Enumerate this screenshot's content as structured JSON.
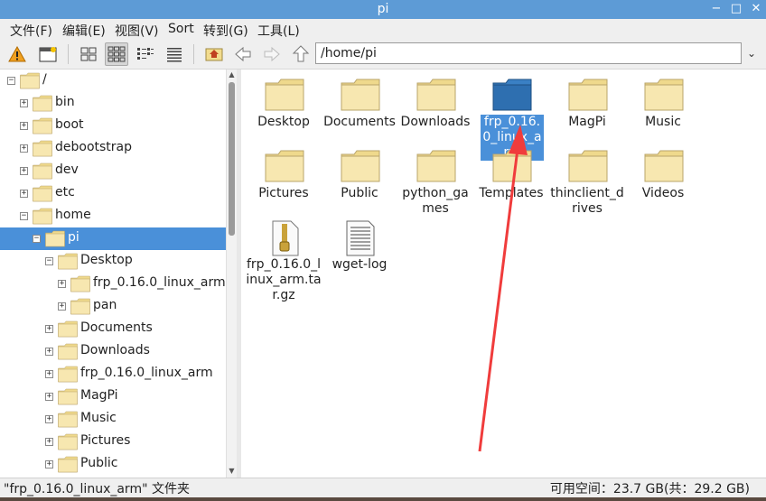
{
  "window": {
    "title": "pi",
    "minimize": "−",
    "maximize": "□",
    "close": "✕"
  },
  "menu": [
    "文件(F)",
    "编辑(E)",
    "视图(V)",
    "Sort",
    "转到(G)",
    "工具(L)"
  ],
  "toolbar": {
    "icons": [
      "warning-icon",
      "new-window-icon",
      "icon-view-icon",
      "thumbnail-view-icon",
      "compact-view-icon",
      "list-view-icon",
      "home-icon",
      "back-icon",
      "forward-icon",
      "up-icon"
    ],
    "address": "/home/pi",
    "address_dropdown": "⌄"
  },
  "tree": [
    {
      "label": "/",
      "expander": "−"
    },
    {
      "label": "bin",
      "expander": "+"
    },
    {
      "label": "boot",
      "expander": "+"
    },
    {
      "label": "debootstrap",
      "expander": "+"
    },
    {
      "label": "dev",
      "expander": "+"
    },
    {
      "label": "etc",
      "expander": "+"
    },
    {
      "label": "home",
      "expander": "−"
    },
    {
      "label": "pi",
      "expander": "−"
    },
    {
      "label": "Desktop",
      "expander": "−"
    },
    {
      "label": "frp_0.16.0_linux_arm",
      "expander": "+"
    },
    {
      "label": "pan",
      "expander": "+"
    },
    {
      "label": "Documents",
      "expander": "+"
    },
    {
      "label": "Downloads",
      "expander": "+"
    },
    {
      "label": "frp_0.16.0_linux_arm",
      "expander": "+"
    },
    {
      "label": "MagPi",
      "expander": "+"
    },
    {
      "label": "Music",
      "expander": "+"
    },
    {
      "label": "Pictures",
      "expander": "+"
    },
    {
      "label": "Public",
      "expander": "+"
    }
  ],
  "files": [
    {
      "name": "Desktop",
      "type": "folder"
    },
    {
      "name": "Documents",
      "type": "folder"
    },
    {
      "name": "Downloads",
      "type": "folder"
    },
    {
      "name": "frp_0.16.0_linux_arm",
      "type": "folder",
      "selected": true
    },
    {
      "name": "MagPi",
      "type": "folder"
    },
    {
      "name": "Music",
      "type": "folder"
    },
    {
      "name": "Pictures",
      "type": "folder"
    },
    {
      "name": "Public",
      "type": "folder"
    },
    {
      "name": "python_games",
      "type": "folder"
    },
    {
      "name": "Templates",
      "type": "folder"
    },
    {
      "name": "thinclient_drives",
      "type": "folder"
    },
    {
      "name": "Videos",
      "type": "folder"
    },
    {
      "name": "frp_0.16.0_linux_arm.tar.gz",
      "type": "archive"
    },
    {
      "name": "wget-log",
      "type": "text"
    }
  ],
  "status": {
    "left": "\"frp_0.16.0_linux_arm\" 文件夹",
    "right": "可用空间：23.7 GB(共：29.2 GB)"
  },
  "colors": {
    "titlebar": "#5d9bd6",
    "selection": "#4a90d9",
    "folder": "#f2dc8e",
    "selected_folder": "#2e6fb0",
    "annotation_arrow": "#f03c3c"
  }
}
